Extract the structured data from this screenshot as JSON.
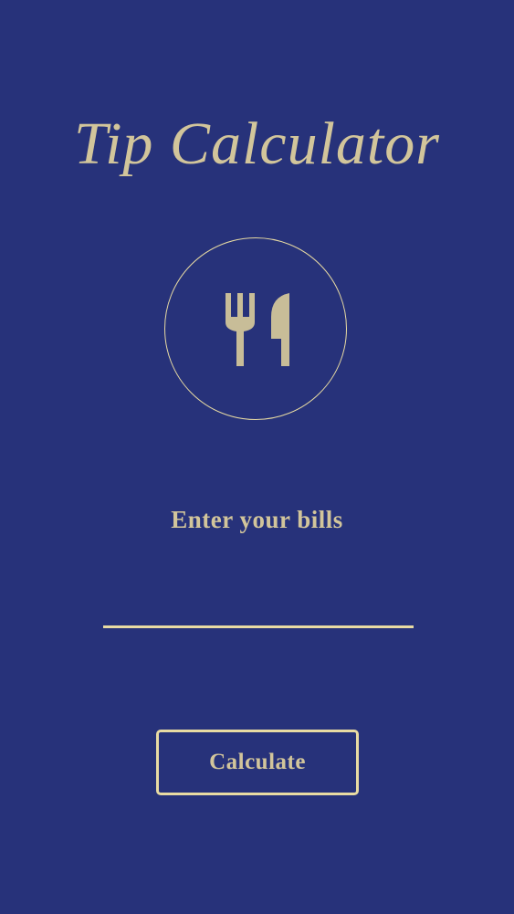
{
  "app": {
    "title": "Tip Calculator"
  },
  "logo": {
    "icon": "fork-knife-icon",
    "accent_color": "#e8dba3",
    "icon_color": "#c8bd98"
  },
  "bill": {
    "prompt": "Enter your bills",
    "value": "",
    "placeholder": ""
  },
  "actions": {
    "calculate_label": "Calculate"
  },
  "theme": {
    "background": "#27327a",
    "text": "#d2c59b"
  }
}
